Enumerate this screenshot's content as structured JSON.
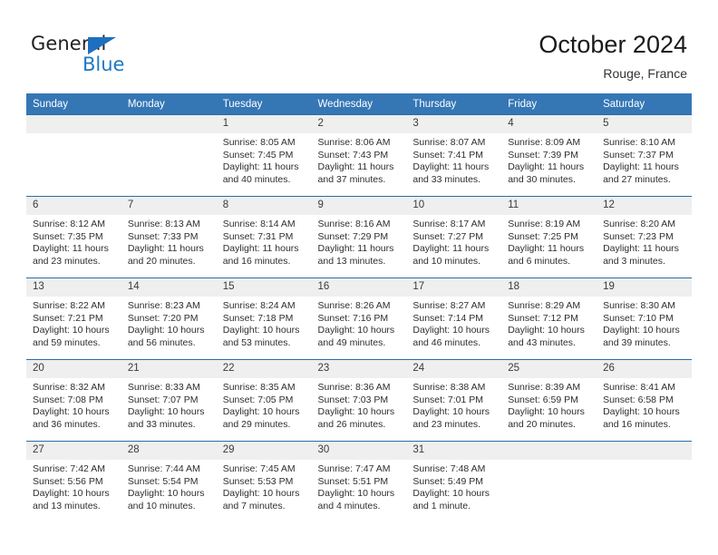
{
  "brand": {
    "name_line1": "General",
    "name_line2": "Blue",
    "triangle_color": "#1f6fc0",
    "blue_color": "#1f7ac4"
  },
  "header": {
    "title": "October 2024",
    "subtitle": "Rouge, France"
  },
  "theme": {
    "header_bg": "#3576b5",
    "row_border": "#2b6ca8",
    "daynum_bg": "#efefef"
  },
  "calendar": {
    "weekday_headers": [
      "Sunday",
      "Monday",
      "Tuesday",
      "Wednesday",
      "Thursday",
      "Friday",
      "Saturday"
    ],
    "labels": {
      "sunrise": "Sunrise:",
      "sunset": "Sunset:",
      "daylight": "Daylight:"
    },
    "weeks": [
      [
        {
          "day": "",
          "empty": true
        },
        {
          "day": "",
          "empty": true
        },
        {
          "day": "1",
          "sunrise": "Sunrise: 8:05 AM",
          "sunset": "Sunset: 7:45 PM",
          "daylight": "Daylight: 11 hours and 40 minutes."
        },
        {
          "day": "2",
          "sunrise": "Sunrise: 8:06 AM",
          "sunset": "Sunset: 7:43 PM",
          "daylight": "Daylight: 11 hours and 37 minutes."
        },
        {
          "day": "3",
          "sunrise": "Sunrise: 8:07 AM",
          "sunset": "Sunset: 7:41 PM",
          "daylight": "Daylight: 11 hours and 33 minutes."
        },
        {
          "day": "4",
          "sunrise": "Sunrise: 8:09 AM",
          "sunset": "Sunset: 7:39 PM",
          "daylight": "Daylight: 11 hours and 30 minutes."
        },
        {
          "day": "5",
          "sunrise": "Sunrise: 8:10 AM",
          "sunset": "Sunset: 7:37 PM",
          "daylight": "Daylight: 11 hours and 27 minutes."
        }
      ],
      [
        {
          "day": "6",
          "sunrise": "Sunrise: 8:12 AM",
          "sunset": "Sunset: 7:35 PM",
          "daylight": "Daylight: 11 hours and 23 minutes."
        },
        {
          "day": "7",
          "sunrise": "Sunrise: 8:13 AM",
          "sunset": "Sunset: 7:33 PM",
          "daylight": "Daylight: 11 hours and 20 minutes."
        },
        {
          "day": "8",
          "sunrise": "Sunrise: 8:14 AM",
          "sunset": "Sunset: 7:31 PM",
          "daylight": "Daylight: 11 hours and 16 minutes."
        },
        {
          "day": "9",
          "sunrise": "Sunrise: 8:16 AM",
          "sunset": "Sunset: 7:29 PM",
          "daylight": "Daylight: 11 hours and 13 minutes."
        },
        {
          "day": "10",
          "sunrise": "Sunrise: 8:17 AM",
          "sunset": "Sunset: 7:27 PM",
          "daylight": "Daylight: 11 hours and 10 minutes."
        },
        {
          "day": "11",
          "sunrise": "Sunrise: 8:19 AM",
          "sunset": "Sunset: 7:25 PM",
          "daylight": "Daylight: 11 hours and 6 minutes."
        },
        {
          "day": "12",
          "sunrise": "Sunrise: 8:20 AM",
          "sunset": "Sunset: 7:23 PM",
          "daylight": "Daylight: 11 hours and 3 minutes."
        }
      ],
      [
        {
          "day": "13",
          "sunrise": "Sunrise: 8:22 AM",
          "sunset": "Sunset: 7:21 PM",
          "daylight": "Daylight: 10 hours and 59 minutes."
        },
        {
          "day": "14",
          "sunrise": "Sunrise: 8:23 AM",
          "sunset": "Sunset: 7:20 PM",
          "daylight": "Daylight: 10 hours and 56 minutes."
        },
        {
          "day": "15",
          "sunrise": "Sunrise: 8:24 AM",
          "sunset": "Sunset: 7:18 PM",
          "daylight": "Daylight: 10 hours and 53 minutes."
        },
        {
          "day": "16",
          "sunrise": "Sunrise: 8:26 AM",
          "sunset": "Sunset: 7:16 PM",
          "daylight": "Daylight: 10 hours and 49 minutes."
        },
        {
          "day": "17",
          "sunrise": "Sunrise: 8:27 AM",
          "sunset": "Sunset: 7:14 PM",
          "daylight": "Daylight: 10 hours and 46 minutes."
        },
        {
          "day": "18",
          "sunrise": "Sunrise: 8:29 AM",
          "sunset": "Sunset: 7:12 PM",
          "daylight": "Daylight: 10 hours and 43 minutes."
        },
        {
          "day": "19",
          "sunrise": "Sunrise: 8:30 AM",
          "sunset": "Sunset: 7:10 PM",
          "daylight": "Daylight: 10 hours and 39 minutes."
        }
      ],
      [
        {
          "day": "20",
          "sunrise": "Sunrise: 8:32 AM",
          "sunset": "Sunset: 7:08 PM",
          "daylight": "Daylight: 10 hours and 36 minutes."
        },
        {
          "day": "21",
          "sunrise": "Sunrise: 8:33 AM",
          "sunset": "Sunset: 7:07 PM",
          "daylight": "Daylight: 10 hours and 33 minutes."
        },
        {
          "day": "22",
          "sunrise": "Sunrise: 8:35 AM",
          "sunset": "Sunset: 7:05 PM",
          "daylight": "Daylight: 10 hours and 29 minutes."
        },
        {
          "day": "23",
          "sunrise": "Sunrise: 8:36 AM",
          "sunset": "Sunset: 7:03 PM",
          "daylight": "Daylight: 10 hours and 26 minutes."
        },
        {
          "day": "24",
          "sunrise": "Sunrise: 8:38 AM",
          "sunset": "Sunset: 7:01 PM",
          "daylight": "Daylight: 10 hours and 23 minutes."
        },
        {
          "day": "25",
          "sunrise": "Sunrise: 8:39 AM",
          "sunset": "Sunset: 6:59 PM",
          "daylight": "Daylight: 10 hours and 20 minutes."
        },
        {
          "day": "26",
          "sunrise": "Sunrise: 8:41 AM",
          "sunset": "Sunset: 6:58 PM",
          "daylight": "Daylight: 10 hours and 16 minutes."
        }
      ],
      [
        {
          "day": "27",
          "sunrise": "Sunrise: 7:42 AM",
          "sunset": "Sunset: 5:56 PM",
          "daylight": "Daylight: 10 hours and 13 minutes."
        },
        {
          "day": "28",
          "sunrise": "Sunrise: 7:44 AM",
          "sunset": "Sunset: 5:54 PM",
          "daylight": "Daylight: 10 hours and 10 minutes."
        },
        {
          "day": "29",
          "sunrise": "Sunrise: 7:45 AM",
          "sunset": "Sunset: 5:53 PM",
          "daylight": "Daylight: 10 hours and 7 minutes."
        },
        {
          "day": "30",
          "sunrise": "Sunrise: 7:47 AM",
          "sunset": "Sunset: 5:51 PM",
          "daylight": "Daylight: 10 hours and 4 minutes."
        },
        {
          "day": "31",
          "sunrise": "Sunrise: 7:48 AM",
          "sunset": "Sunset: 5:49 PM",
          "daylight": "Daylight: 10 hours and 1 minute."
        },
        {
          "day": "",
          "empty": true
        },
        {
          "day": "",
          "empty": true
        }
      ]
    ]
  }
}
